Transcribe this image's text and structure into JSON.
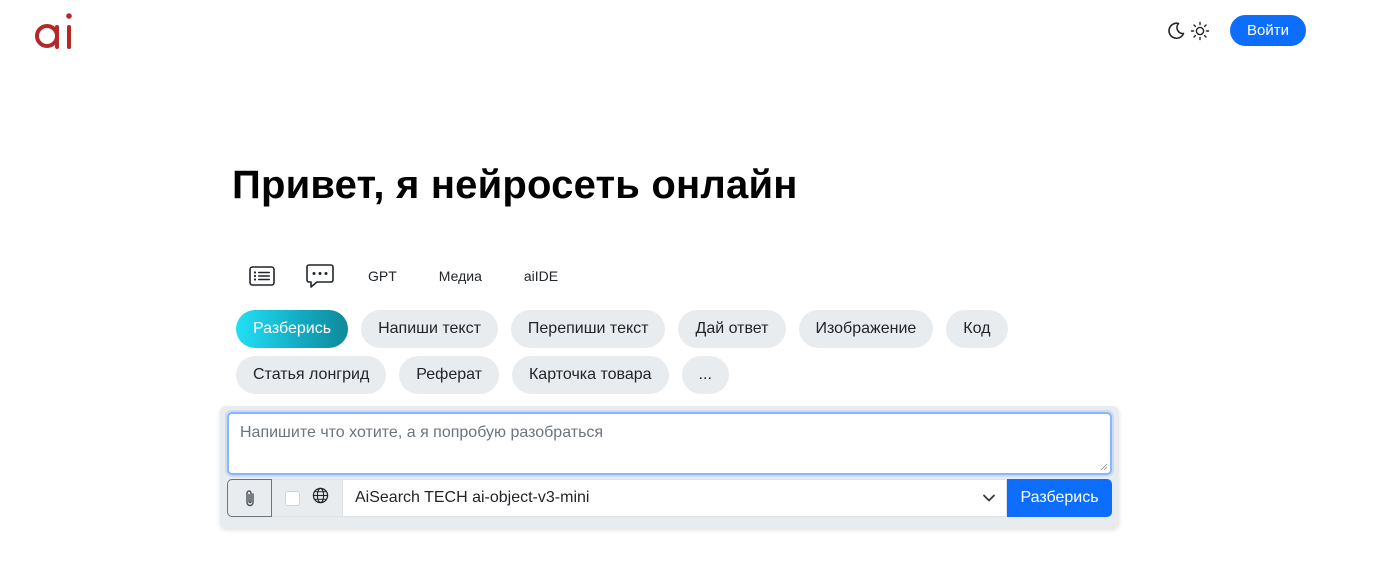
{
  "header": {
    "logo_text": "ai",
    "moon_icon": "moon-icon",
    "sun_icon": "sun-icon",
    "login_label": "Войти"
  },
  "hero": {
    "title": "Привет, я нейросеть онлайн"
  },
  "tabs": [
    {
      "icon": "list-icon"
    },
    {
      "icon": "chat-dots-icon"
    },
    {
      "label": "GPT"
    },
    {
      "label": "Медиа"
    },
    {
      "label": "aiIDE"
    }
  ],
  "chips": {
    "row1": [
      "Разберись",
      "Напиши текст",
      "Перепиши текст",
      "Дай ответ",
      "Изображение",
      "Код"
    ],
    "row2": [
      "Статья лонгрид",
      "Реферат",
      "Карточка товара",
      "..."
    ]
  },
  "composer": {
    "placeholder": "Напишите что хотите, а я попробую разобраться",
    "value": "",
    "attach_icon": "paperclip-icon",
    "web_search_icon": "globe-icon",
    "model_selected": "AiSearch TECH ai-object-v3-mini",
    "submit_label": "Разберись"
  },
  "colors": {
    "primary": "#0d6efd",
    "logo": "#b5282a",
    "chip_bg": "#e9ecef",
    "chip_active_start": "#22e0f5",
    "chip_active_end": "#0f8a9a"
  }
}
